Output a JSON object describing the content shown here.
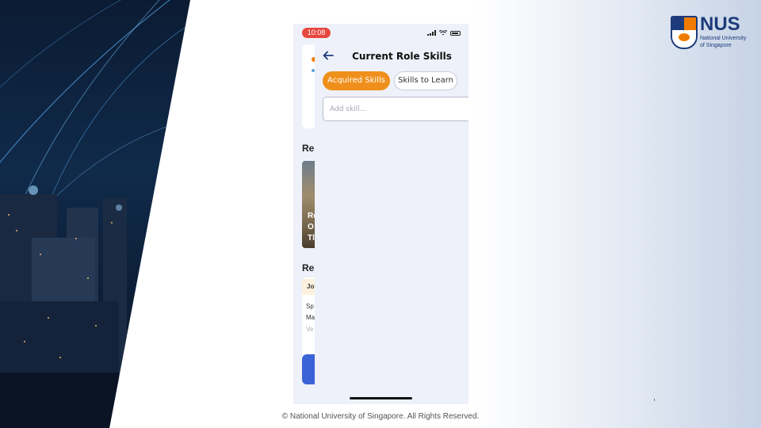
{
  "statusbar": {
    "time": "10:08"
  },
  "logo": {
    "wordmark": "NUS",
    "subtitle": "National University of Singapore"
  },
  "underlying": {
    "heading_1": "Re",
    "heading_2": "Re",
    "image_lines": [
      "Re",
      "O",
      "Tl"
    ],
    "tag": "Jol",
    "text_lines": [
      "Sp",
      "Ma",
      "Ve"
    ]
  },
  "panel": {
    "title": "Current Role Skills",
    "tabs": [
      {
        "label": "Acquired Skills",
        "active": true
      },
      {
        "label": "Skills to Learn",
        "active": false
      }
    ],
    "input": {
      "placeholder": "Add skill...",
      "value": ""
    }
  },
  "footer": {
    "copyright": "© National University of Singapore. All Rights Reserved."
  },
  "colors": {
    "accent": "#f0901c",
    "status_pill": "#e8473f",
    "nus_blue": "#1d3b7a",
    "nus_orange": "#ef7c00"
  }
}
